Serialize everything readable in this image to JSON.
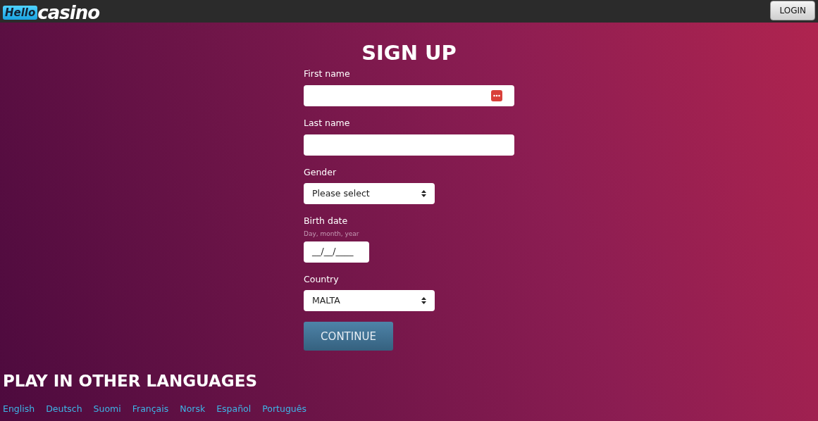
{
  "header": {
    "logo": {
      "badge": "Hello",
      "word": "casino"
    },
    "login_button": "LOGIN"
  },
  "form": {
    "title": "SIGN UP",
    "fields": [
      {
        "kind": "text",
        "label": "First name",
        "icon": true
      },
      {
        "kind": "text",
        "label": "Last name",
        "icon": false
      },
      {
        "kind": "select",
        "label": "Gender",
        "value": "Please select"
      },
      {
        "kind": "date",
        "label": "Birth date",
        "hint": "Day, month, year",
        "value": "__/__/____"
      },
      {
        "kind": "select",
        "label": "Country",
        "value": "MALTA"
      }
    ],
    "submit": "CONTINUE"
  },
  "languages": {
    "title": "PLAY IN OTHER LANGUAGES",
    "links": [
      "English",
      "Deutsch",
      "Suomi",
      "Français",
      "Norsk",
      "Español",
      "Português"
    ]
  }
}
